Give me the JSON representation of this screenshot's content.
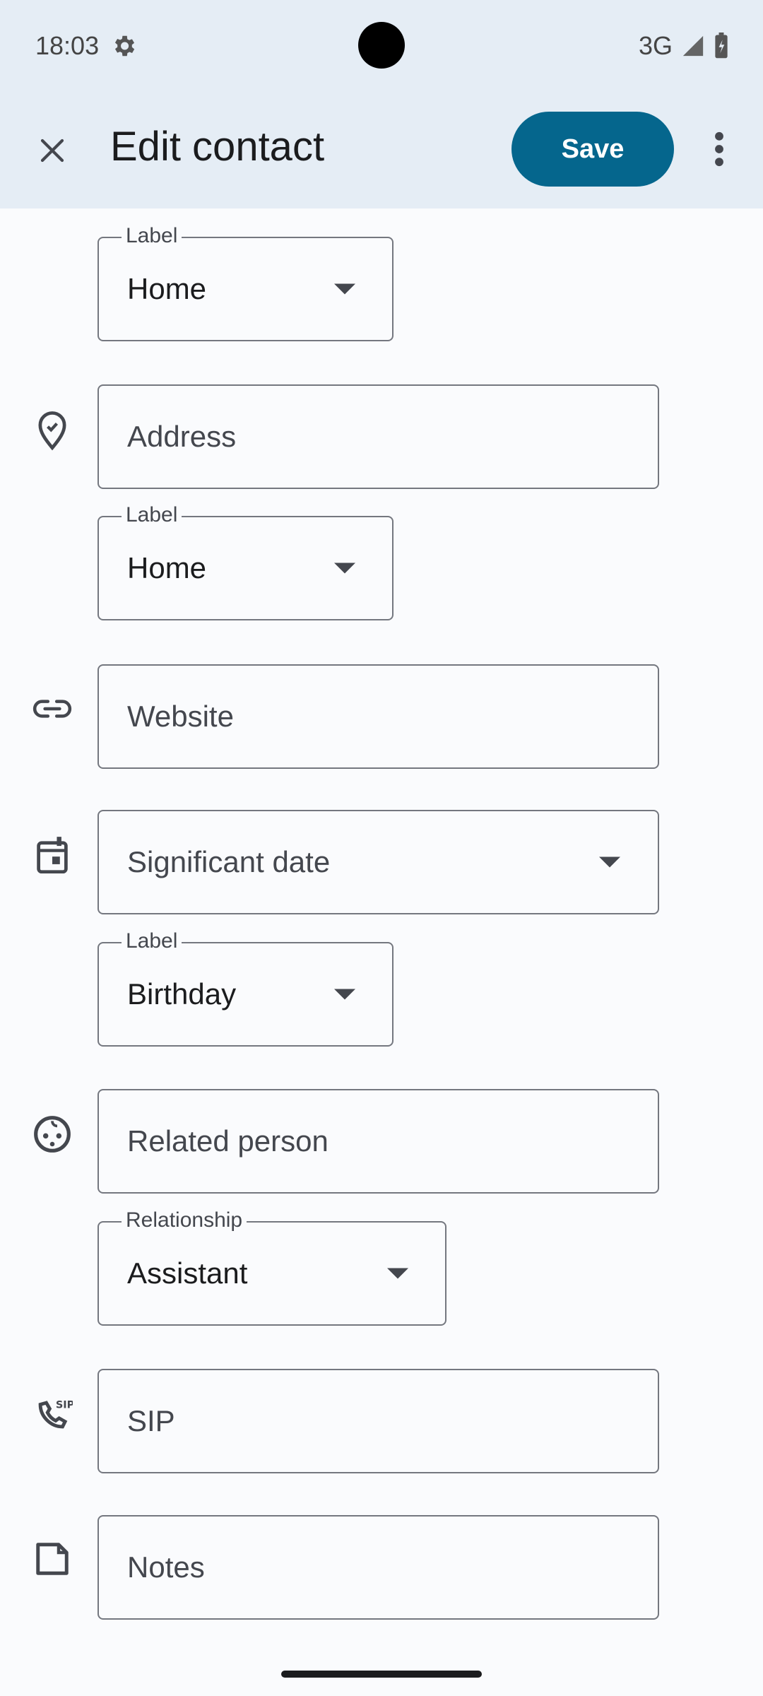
{
  "status_bar": {
    "time": "18:03",
    "network": "3G"
  },
  "app_bar": {
    "title": "Edit contact",
    "save_label": "Save"
  },
  "phone_label": {
    "label": "Label",
    "value": "Home"
  },
  "address": {
    "placeholder": "Address",
    "label": "Label",
    "label_value": "Home"
  },
  "website": {
    "placeholder": "Website"
  },
  "significant_date": {
    "placeholder": "Significant date",
    "label": "Label",
    "label_value": "Birthday"
  },
  "related_person": {
    "placeholder": "Related person",
    "label": "Relationship",
    "label_value": "Assistant"
  },
  "sip": {
    "placeholder": "SIP"
  },
  "notes": {
    "placeholder": "Notes"
  },
  "colors": {
    "accent": "#05668D",
    "app_bar_bg": "#E5EDF5",
    "outline": "#74777F"
  }
}
